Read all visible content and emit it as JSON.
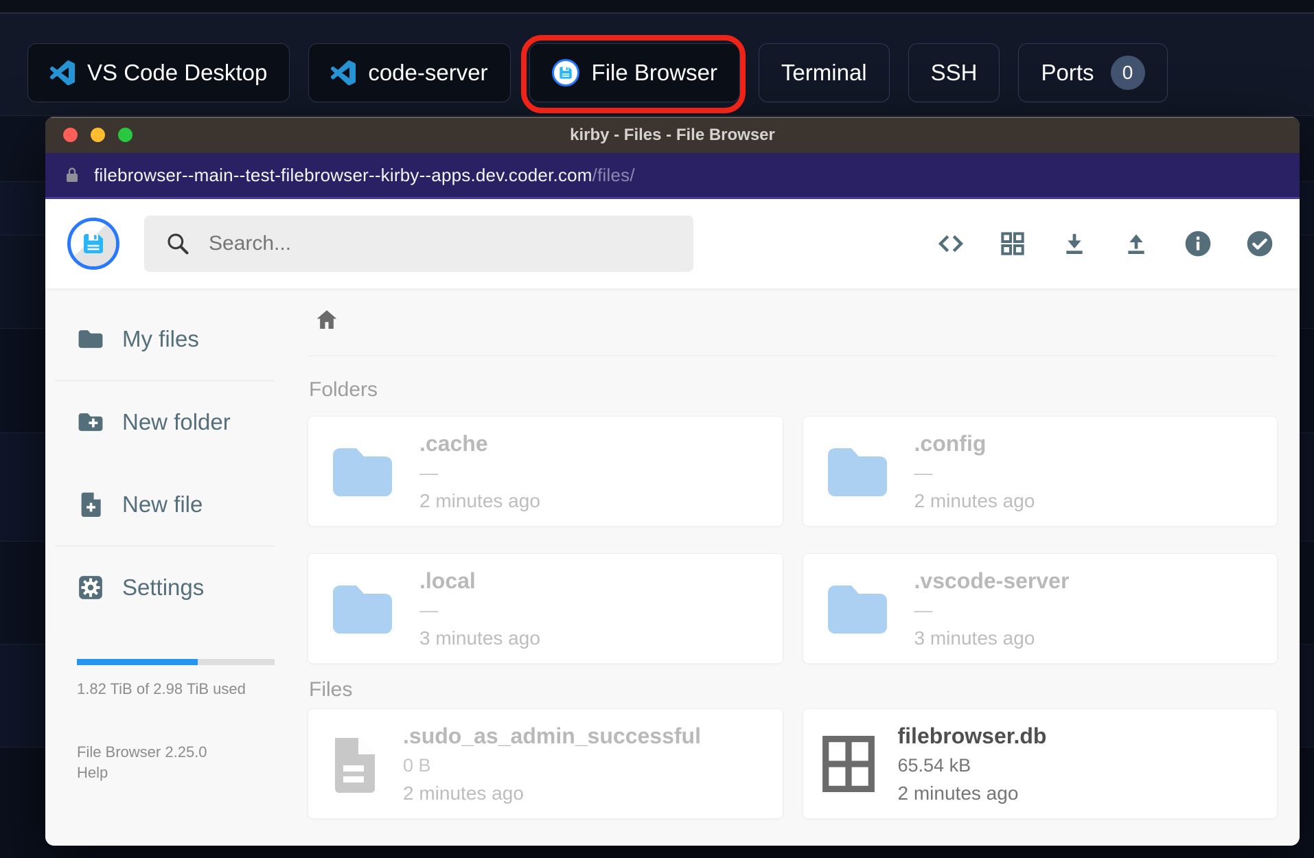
{
  "topbar": {
    "buttons": [
      {
        "label": "VS Code Desktop"
      },
      {
        "label": "code-server"
      },
      {
        "label": "File Browser"
      },
      {
        "label": "Terminal"
      },
      {
        "label": "SSH"
      },
      {
        "label": "Ports",
        "badge": "0"
      }
    ]
  },
  "window": {
    "title": "kirby - Files - File Browser",
    "url_host": "filebrowser--main--test-filebrowser--kirby--apps.dev.coder.com",
    "url_path": "/files/"
  },
  "toolbar": {
    "search_placeholder": "Search...",
    "icons": [
      "code",
      "grid-view",
      "download",
      "upload",
      "info",
      "check-circle"
    ]
  },
  "sidebar": {
    "items": [
      {
        "label": "My files",
        "icon": "folder"
      },
      {
        "label": "New folder",
        "icon": "create-new-folder"
      },
      {
        "label": "New file",
        "icon": "note-add"
      },
      {
        "label": "Settings",
        "icon": "settings-gear"
      }
    ],
    "usage": {
      "label": "1.82 TiB of 2.98 TiB used",
      "percent": 61
    },
    "version": "File Browser 2.25.0",
    "help": "Help"
  },
  "content": {
    "folders_header": "Folders",
    "files_header": "Files",
    "folders": [
      {
        "name": ".cache",
        "size": "—",
        "modified": "2 minutes ago",
        "hidden": true
      },
      {
        "name": ".config",
        "size": "—",
        "modified": "2 minutes ago",
        "hidden": true
      },
      {
        "name": ".local",
        "size": "—",
        "modified": "3 minutes ago",
        "hidden": true
      },
      {
        "name": ".vscode-server",
        "size": "—",
        "modified": "3 minutes ago",
        "hidden": true
      }
    ],
    "files": [
      {
        "name": ".sudo_as_admin_successful",
        "size": "0 B",
        "modified": "2 minutes ago",
        "hidden": true,
        "icon": "file"
      },
      {
        "name": "filebrowser.db",
        "size": "65.54 kB",
        "modified": "2 minutes ago",
        "hidden": false,
        "icon": "db-grid"
      }
    ]
  },
  "colors": {
    "accent_blue": "#2196f3",
    "logo_ring": "#2979ff",
    "floppy_blue": "#29b6f6",
    "slate": "#546e7a",
    "highlight_red": "#ee2419",
    "url_bar": "#2a2164",
    "title_bar": "#3b342f"
  }
}
